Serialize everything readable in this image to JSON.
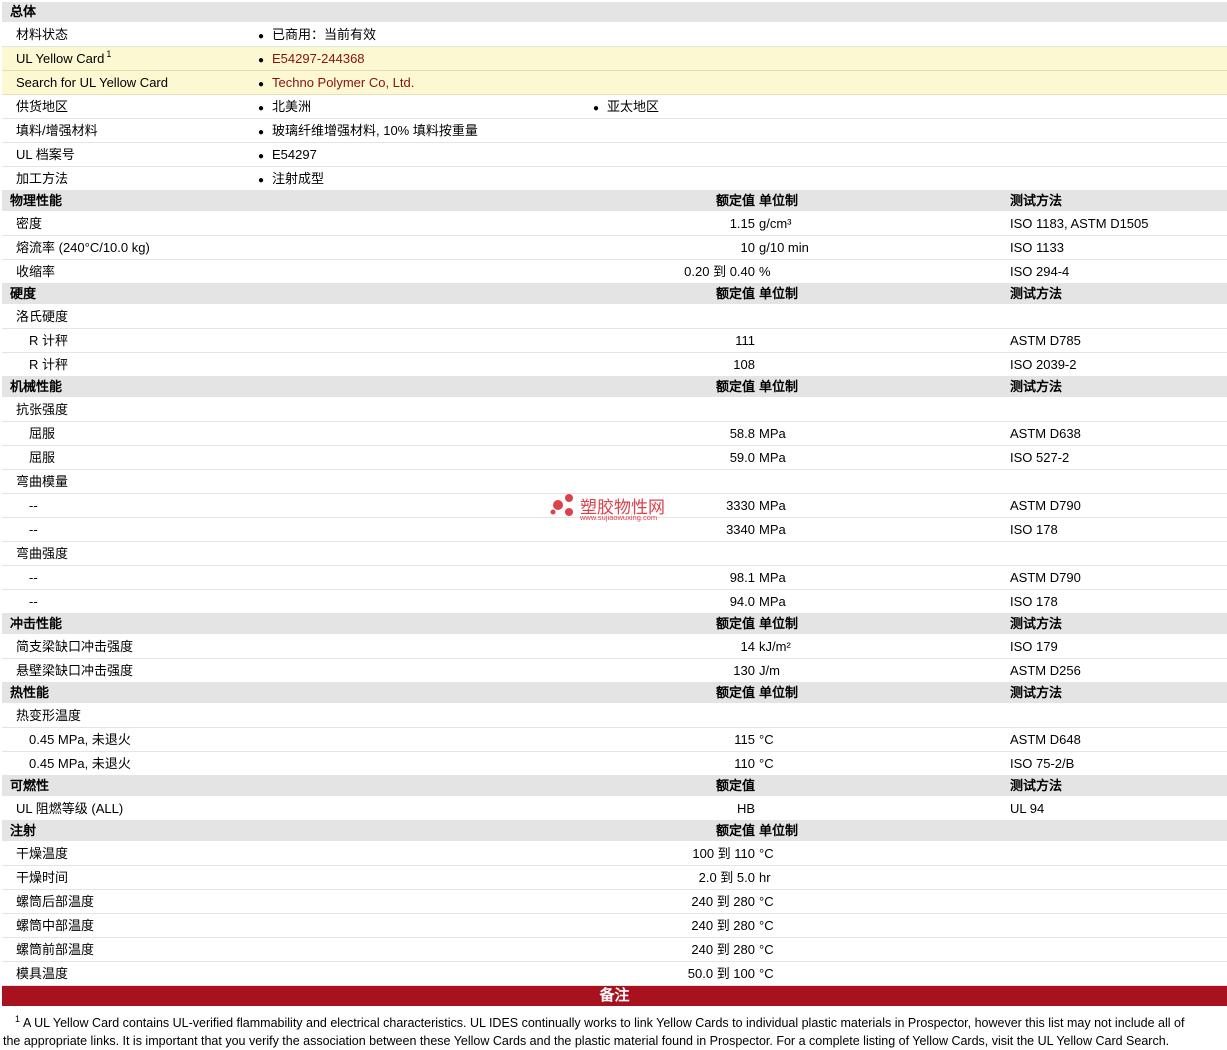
{
  "general": {
    "title": "总体",
    "rows": [
      {
        "label": "材料状态",
        "items": [
          "已商用：当前有效"
        ],
        "highlight": false
      },
      {
        "label": "UL Yellow Card",
        "sup": "1",
        "items": [
          "E54297-244368"
        ],
        "highlight": true,
        "link": true
      },
      {
        "label": "Search for UL Yellow Card",
        "items": [
          "Techno Polymer Co, Ltd."
        ],
        "highlight": true,
        "link": true
      },
      {
        "label": "供货地区",
        "items": [
          "北美洲",
          "亚太地区"
        ],
        "highlight": false
      },
      {
        "label": "填料/增强材料",
        "items": [
          "玻璃纤维增强材料, 10% 填料按重量"
        ],
        "highlight": false
      },
      {
        "label": "UL 档案号",
        "items": [
          "E54297"
        ],
        "highlight": false
      },
      {
        "label": "加工方法",
        "items": [
          "注射成型"
        ],
        "highlight": false
      }
    ]
  },
  "sections": [
    {
      "title": "物理性能",
      "value_header": "额定值",
      "unit_header": "单位制",
      "method_header": "测试方法",
      "rows": [
        {
          "label": "密度",
          "value": "1.15",
          "unit": "g/cm³",
          "method": "ISO 1183, ASTM D1505"
        },
        {
          "label": "熔流率 (240°C/10.0 kg)",
          "value": "10",
          "unit": "g/10 min",
          "method": "ISO 1133"
        },
        {
          "label": "收缩率",
          "value": "0.20 到  0.40",
          "unit": "%",
          "method": "ISO 294-4"
        }
      ]
    },
    {
      "title": "硬度",
      "value_header": "额定值",
      "unit_header": "单位制",
      "method_header": "测试方法",
      "rows": [
        {
          "label": "洛氏硬度",
          "value": "",
          "unit": "",
          "method": ""
        },
        {
          "label": "R 计秤",
          "indent": true,
          "value": "111",
          "unit": "",
          "method": "ASTM D785"
        },
        {
          "label": "R 计秤",
          "indent": true,
          "value": "108",
          "unit": "",
          "method": "ISO 2039-2"
        }
      ]
    },
    {
      "title": "机械性能",
      "value_header": "额定值",
      "unit_header": "单位制",
      "method_header": "测试方法",
      "rows": [
        {
          "label": "抗张强度",
          "value": "",
          "unit": "",
          "method": ""
        },
        {
          "label": "屈服",
          "indent": true,
          "value": "58.8",
          "unit": "MPa",
          "method": "ASTM D638"
        },
        {
          "label": "屈服",
          "indent": true,
          "value": "59.0",
          "unit": "MPa",
          "method": "ISO 527-2"
        },
        {
          "label": "弯曲模量",
          "value": "",
          "unit": "",
          "method": ""
        },
        {
          "label": "--",
          "indent": true,
          "value": "3330",
          "unit": "MPa",
          "method": "ASTM D790"
        },
        {
          "label": "--",
          "indent": true,
          "value": "3340",
          "unit": "MPa",
          "method": "ISO 178"
        },
        {
          "label": "弯曲强度",
          "value": "",
          "unit": "",
          "method": ""
        },
        {
          "label": "--",
          "indent": true,
          "value": "98.1",
          "unit": "MPa",
          "method": "ASTM D790"
        },
        {
          "label": "--",
          "indent": true,
          "value": "94.0",
          "unit": "MPa",
          "method": "ISO 178"
        }
      ]
    },
    {
      "title": "冲击性能",
      "value_header": "额定值",
      "unit_header": "单位制",
      "method_header": "测试方法",
      "rows": [
        {
          "label": "简支梁缺口冲击强度",
          "value": "14",
          "unit": "kJ/m²",
          "method": "ISO 179"
        },
        {
          "label": "悬壁梁缺口冲击强度",
          "value": "130",
          "unit": "J/m",
          "method": "ASTM D256"
        }
      ]
    },
    {
      "title": "热性能",
      "value_header": "额定值",
      "unit_header": "单位制",
      "method_header": "测试方法",
      "rows": [
        {
          "label": "热变形温度",
          "value": "",
          "unit": "",
          "method": ""
        },
        {
          "label": "0.45 MPa, 未退火",
          "indent": true,
          "value": "115",
          "unit": "°C",
          "method": "ASTM D648"
        },
        {
          "label": "0.45 MPa, 未退火",
          "indent": true,
          "value": "110",
          "unit": "°C",
          "method": "ISO 75-2/B"
        }
      ]
    },
    {
      "title": "可燃性",
      "value_header": "额定值",
      "unit_header": "",
      "method_header": "测试方法",
      "rows": [
        {
          "label": "UL 阻燃等级 (ALL)",
          "value": "HB",
          "unit": "",
          "method": "UL 94"
        }
      ]
    },
    {
      "title": "注射",
      "value_header": "额定值",
      "unit_header": "单位制",
      "method_header": "",
      "rows": [
        {
          "label": "干燥温度",
          "value": "100 到  110",
          "unit": "°C",
          "method": ""
        },
        {
          "label": "干燥时间",
          "value": "2.0 到  5.0",
          "unit": "hr",
          "method": ""
        },
        {
          "label": "螺筒后部温度",
          "value": "240 到  280",
          "unit": "°C",
          "method": ""
        },
        {
          "label": "螺筒中部温度",
          "value": "240 到  280",
          "unit": "°C",
          "method": ""
        },
        {
          "label": "螺筒前部温度",
          "value": "240 到  280",
          "unit": "°C",
          "method": ""
        },
        {
          "label": "模具温度",
          "value": "50.0 到  100",
          "unit": "°C",
          "method": ""
        }
      ]
    }
  ],
  "notes": {
    "title": "备注",
    "sup": "1",
    "line1": "A UL Yellow Card contains UL-verified flammability and electrical characteristics. UL IDES continually works to link Yellow Cards to individual plastic materials in Prospector, however this list may not include all of",
    "line2": "the appropriate links. It is important that you verify the association between these Yellow Cards and the plastic material found in Prospector. For a complete listing of Yellow Cards, visit the UL Yellow Card Search."
  },
  "watermark": {
    "name": "塑胶物性网",
    "url": "www.sujiaowuxing.com",
    "color": "#d8202a"
  },
  "colors": {
    "section_bg": "#e4e4e4",
    "highlight_bg": "#fbf8d2",
    "link": "#8a1010",
    "notes_bar": "#a8111e"
  }
}
